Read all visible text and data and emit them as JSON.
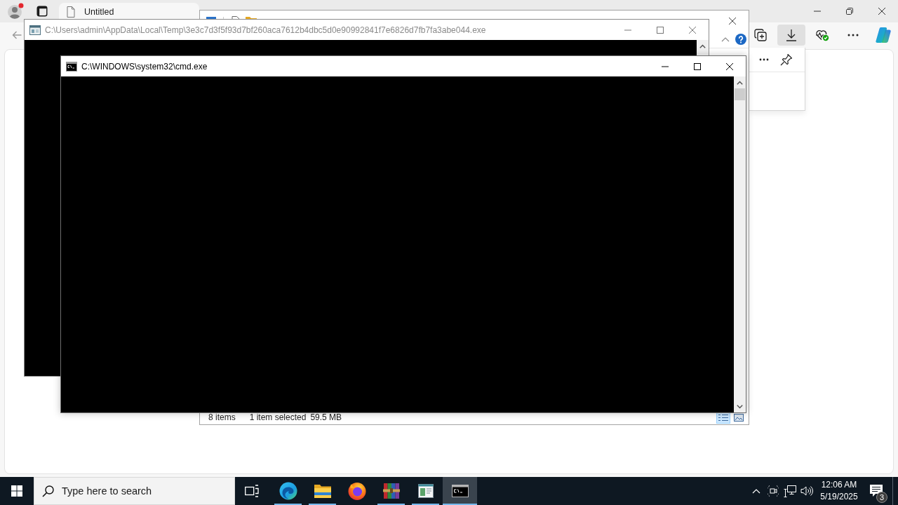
{
  "browser": {
    "profile": {
      "notification": true
    },
    "tabs": [
      {
        "title": "Untitled",
        "selected": true
      }
    ],
    "toolbar": [
      {
        "kind": "collections",
        "selected": false
      },
      {
        "kind": "downloads",
        "selected": true
      },
      {
        "kind": "health",
        "selected": false
      },
      {
        "kind": "more",
        "selected": false
      },
      {
        "kind": "copilot",
        "selected": false
      }
    ]
  },
  "explorer": {
    "status": [
      "8 items",
      "1 item selected",
      "59.5 MB"
    ],
    "views": [
      {
        "kind": "details",
        "selected": true
      },
      {
        "kind": "large_icons",
        "selected": false
      }
    ]
  },
  "consoles": [
    {
      "kind": "app",
      "title": "C:\\Users\\admin\\AppData\\Local\\Temp\\3e3c7d3f5f93d7bf260aca7612b4dbc5d0e90992841f7e6826d7fb7fa3abe044.exe",
      "active": false
    },
    {
      "kind": "cmd",
      "title": "C:\\WINDOWS\\system32\\cmd.exe",
      "active": true
    }
  ],
  "taskbar": {
    "search": {
      "placeholder": "Type here to search"
    },
    "apps": [
      {
        "kind": "edge",
        "running": true,
        "selected": false
      },
      {
        "kind": "explorer",
        "running": true,
        "selected": false
      },
      {
        "kind": "firefox",
        "running": false,
        "selected": false
      },
      {
        "kind": "winrar",
        "running": true,
        "selected": false
      },
      {
        "kind": "form_app",
        "running": true,
        "selected": false
      },
      {
        "kind": "cmd",
        "running": true,
        "selected": true
      }
    ],
    "clock": {
      "time": "12:06 AM",
      "date": "5/19/2025"
    },
    "notifications": {
      "count": "3"
    }
  }
}
